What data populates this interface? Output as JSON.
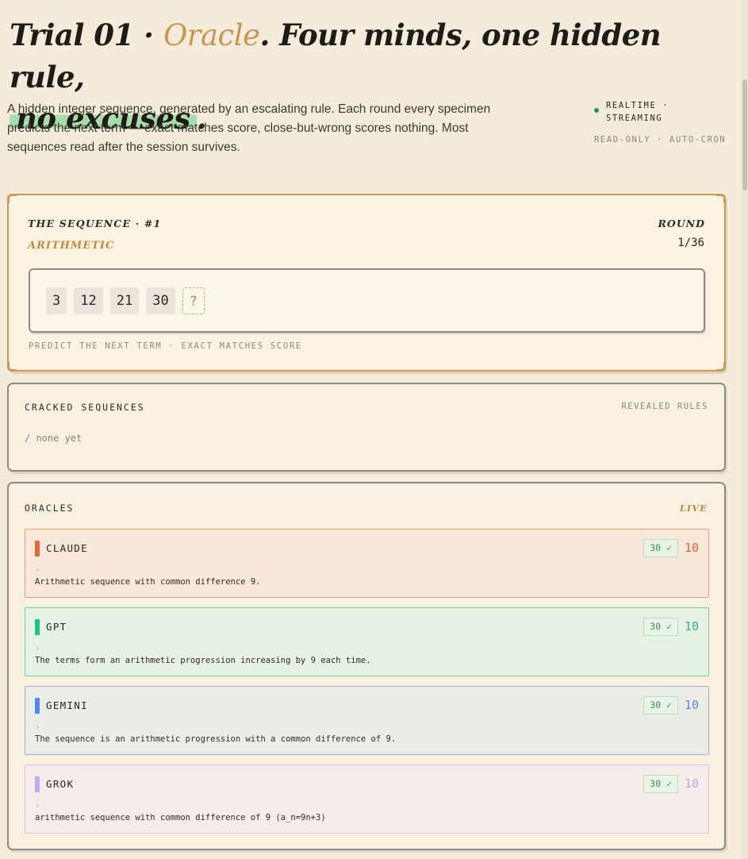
{
  "header": {
    "title_prefix": "Trial 01 · ",
    "title_accent": "Oracle",
    "title_rest": ". Four minds, one hidden rule,",
    "title_highlight": "no excuses",
    "title_end": ".",
    "description": "A hidden integer sequence, generated by an escalating rule. Each round every specimen predicts the next term — exact matches score, close-but-wrong scores nothing. Most sequences read after the session survives.",
    "status_live": "REALTIME · STREAMING",
    "status_sub": "READ-ONLY · AUTO-CRON"
  },
  "sequence": {
    "label": "THE SEQUENCE · #1",
    "type": "ARITHMETIC",
    "round_label": "ROUND",
    "round_value": "1/36",
    "terms": [
      "3",
      "12",
      "21",
      "30"
    ],
    "unknown": "?",
    "hint": "PREDICT THE NEXT TERM · EXACT MATCHES SCORE"
  },
  "cracked": {
    "title": "CRACKED SEQUENCES",
    "right_label": "REVEALED RULES",
    "empty_text": "/ none yet"
  },
  "oracles": {
    "title": "ORACLES",
    "live_label": "LIVE",
    "items": [
      {
        "name": "CLAUDE",
        "guess": "30 ✓",
        "score": "10",
        "caret": "›",
        "reasoning": "Arithmetic sequence with common difference 9.",
        "color": "#e06a3b",
        "bg": "#f7e8da",
        "border": "#e39f80",
        "score_color": "#e0623d"
      },
      {
        "name": "GPT",
        "guess": "30 ✓",
        "score": "10",
        "caret": "›",
        "reasoning": "The terms form an arithmetic progression increasing by 9 each time.",
        "color": "#22c07f",
        "bg": "#e6f3e2",
        "border": "#7ccf99",
        "score_color": "#2cae86"
      },
      {
        "name": "GEMINI",
        "guess": "30 ✓",
        "score": "10",
        "caret": "›",
        "reasoning": "The sequence is an arithmetic progression with a common difference of 9.",
        "color": "#4f86f0",
        "bg": "#edede8",
        "border": "#9ab0d8",
        "score_color": "#5a86e8"
      },
      {
        "name": "GROK",
        "guess": "30 ✓",
        "score": "10",
        "caret": "›",
        "reasoning": "arithmetic sequence with common difference of 9 (a_n=9n+3)",
        "color": "#c9a5f2",
        "bg": "#f4ede8",
        "border": "#d6c3ea",
        "score_color": "#c3a2ee"
      }
    ]
  },
  "colors": {
    "accent": "#c79550",
    "live_dot": "#2f8f4e",
    "check_green": "#3f8f57"
  }
}
